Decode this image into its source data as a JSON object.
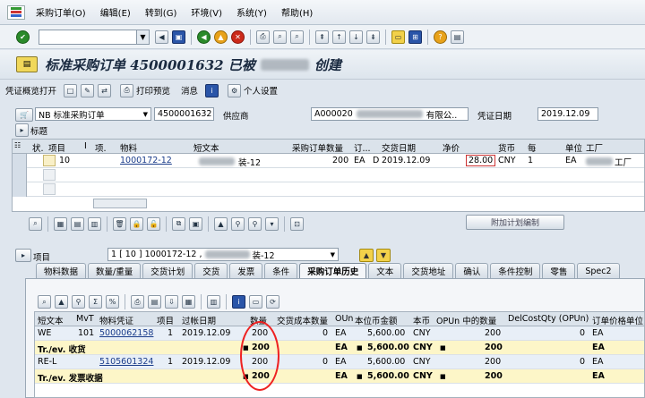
{
  "menu": {
    "items": [
      "采购订单(O)",
      "编辑(E)",
      "转到(G)",
      "环境(V)",
      "系统(Y)",
      "帮助(H)"
    ]
  },
  "title": {
    "prefix": "标准采购订单 4500001632 已被",
    "suffix": "创建"
  },
  "app_toolbar": {
    "btn1": "凭证概览打开",
    "print_preview": "打印预览",
    "messages": "消息",
    "personal": "个人设置"
  },
  "header": {
    "doc_type": "NB 标准采购订单",
    "po_number": "4500001632",
    "vendor_label": "供应商",
    "vendor_code": "A000020",
    "vendor_suffix": "有限公..",
    "doc_date_label": "凭证日期",
    "doc_date": "2019.12.09",
    "header_section": "标题"
  },
  "items_grid": {
    "columns": [
      "状.",
      "项目",
      "I",
      "项.",
      "物料",
      "短文本",
      "采购订单数量",
      "订...",
      "",
      "交货日期",
      "净价",
      "货币",
      "每",
      "单位",
      "工厂"
    ],
    "rows": [
      {
        "item": "10",
        "material": "1000172-12",
        "short_text_suffix": "装-12",
        "qty": "200",
        "unit": "EA",
        "d": "D",
        "date": "2019.12.09",
        "price": "28.00",
        "currency": "CNY",
        "per": "1",
        "unit2": "EA",
        "plant_suffix": "工厂"
      }
    ]
  },
  "buttons": {
    "acct": "附加计划编制"
  },
  "item_select": {
    "label": "项目",
    "value_prefix": "1 [ 10 ] 1000172-12 ,",
    "value_suffix": "装-12"
  },
  "tabs": [
    "物料数据",
    "数量/重量",
    "交货计划",
    "交货",
    "发票",
    "条件",
    "采购订单历史",
    "文本",
    "交货地址",
    "确认",
    "条件控制",
    "零售",
    "Spec2"
  ],
  "active_tab": "采购订单历史",
  "history": {
    "columns": [
      "短文本",
      "MvT",
      "物料凭证",
      "项目",
      "过帐日期",
      "数量",
      "交货成本数量",
      "OUn",
      "本位币金额",
      "本币",
      "OPUn 中的数量",
      "DelCostQty (OPUn)",
      "订单价格单位"
    ],
    "rows": [
      {
        "type": "row",
        "c": [
          "WE",
          "101",
          "5000062158",
          "1",
          "2019.12.09",
          "200",
          "0",
          "EA",
          "5,600.00",
          "CNY",
          "200",
          "0",
          "EA"
        ]
      },
      {
        "type": "sub",
        "c": [
          "Tr./ev. 收货",
          "",
          "",
          "",
          "",
          "200",
          "",
          "EA",
          "5,600.00",
          "CNY",
          "200",
          "",
          "EA"
        ]
      },
      {
        "type": "row",
        "c": [
          "RE-L",
          "",
          "5105601324",
          "1",
          "2019.12.09",
          "200",
          "0",
          "EA",
          "5,600.00",
          "CNY",
          "200",
          "0",
          "EA"
        ]
      },
      {
        "type": "sub",
        "c": [
          "Tr./ev. 发票收据",
          "",
          "",
          "",
          "",
          "200",
          "",
          "EA",
          "5,600.00",
          "CNY",
          "200",
          "",
          "EA"
        ]
      }
    ]
  }
}
